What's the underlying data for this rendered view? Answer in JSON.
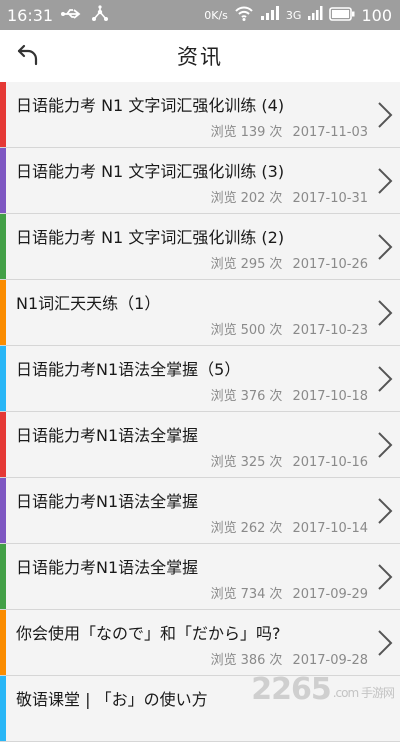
{
  "statusbar": {
    "time": "16:31",
    "data_rate": "0",
    "data_unit": "K/s",
    "network": "3G",
    "battery": "100"
  },
  "header": {
    "title": "资讯"
  },
  "colors": {
    "statusbar": "#9e9e9e",
    "bar_red": "#e53935",
    "bar_purple": "#7e57c2",
    "bar_green": "#43a047",
    "bar_orange": "#fb8c00",
    "bar_blue": "#29b6f6"
  },
  "articles": [
    {
      "title": "日语能力考  N1  文字词汇强化训练 (4)",
      "views_label": "浏览",
      "views": "139",
      "unit": "次",
      "date": "2017-11-03",
      "bar_color": "#e53935"
    },
    {
      "title": "日语能力考  N1  文字词汇强化训练 (3)",
      "views_label": "浏览",
      "views": "202",
      "unit": "次",
      "date": "2017-10-31",
      "bar_color": "#7e57c2"
    },
    {
      "title": "日语能力考  N1  文字词汇强化训练 (2)",
      "views_label": "浏览",
      "views": "295",
      "unit": "次",
      "date": "2017-10-26",
      "bar_color": "#43a047"
    },
    {
      "title": "N1词汇天天练（1）",
      "views_label": "浏览",
      "views": "500",
      "unit": "次",
      "date": "2017-10-23",
      "bar_color": "#fb8c00"
    },
    {
      "title": "日语能力考N1语法全掌握（5）",
      "views_label": "浏览",
      "views": "376",
      "unit": "次",
      "date": "2017-10-18",
      "bar_color": "#29b6f6"
    },
    {
      "title": "日语能力考N1语法全掌握",
      "views_label": "浏览",
      "views": "325",
      "unit": "次",
      "date": "2017-10-16",
      "bar_color": "#e53935"
    },
    {
      "title": "日语能力考N1语法全掌握",
      "views_label": "浏览",
      "views": "262",
      "unit": "次",
      "date": "2017-10-14",
      "bar_color": "#7e57c2"
    },
    {
      "title": "日语能力考N1语法全掌握",
      "views_label": "浏览",
      "views": "734",
      "unit": "次",
      "date": "2017-09-29",
      "bar_color": "#43a047"
    },
    {
      "title": "你会使用「なので」和「だから」吗?",
      "views_label": "浏览",
      "views": "386",
      "unit": "次",
      "date": "2017-09-28",
      "bar_color": "#fb8c00"
    },
    {
      "title": "敬语课堂 | 「お」の使い方",
      "views_label": "",
      "views": "",
      "unit": "",
      "date": "",
      "bar_color": "#29b6f6"
    }
  ],
  "watermark": {
    "brand": "2265",
    "sub": ".com 手游网"
  }
}
